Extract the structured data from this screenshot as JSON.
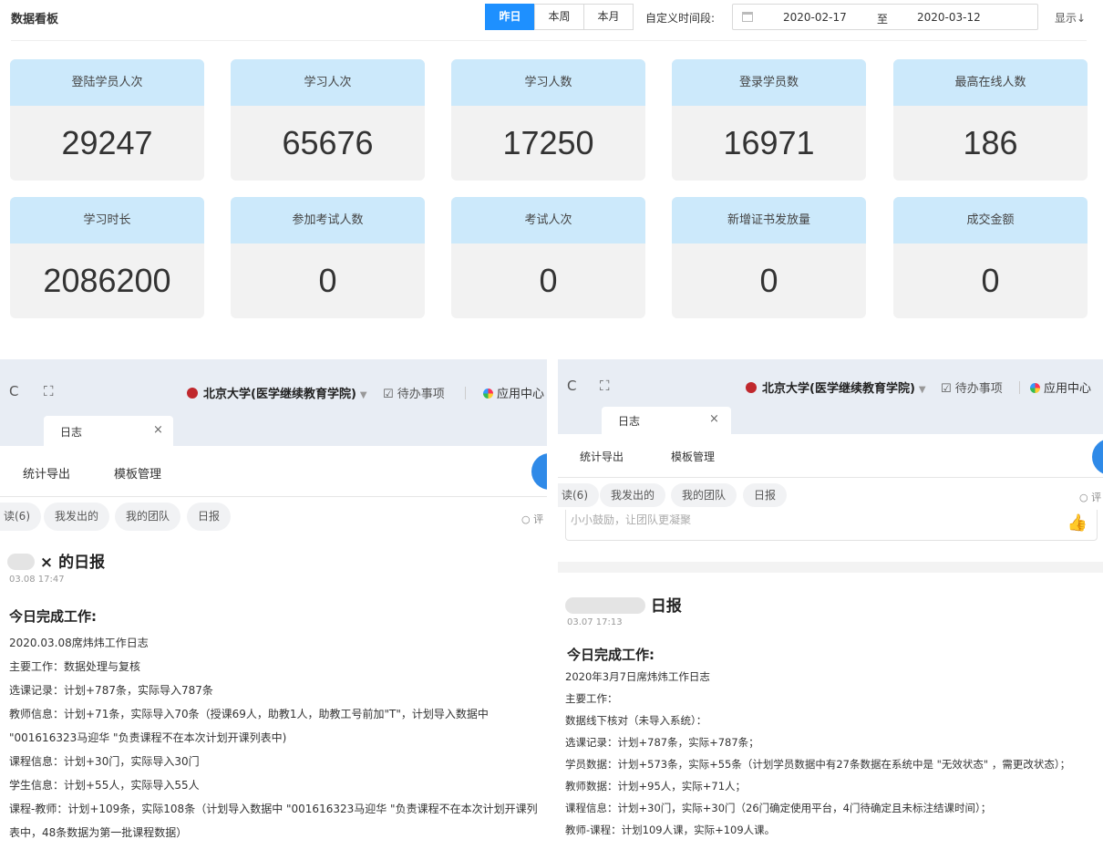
{
  "dashboard": {
    "title": "数据看板",
    "periods": [
      {
        "label": "昨日",
        "active": true
      },
      {
        "label": "本周",
        "active": false
      },
      {
        "label": "本月",
        "active": false
      }
    ],
    "custom_range_label": "自定义时间段:",
    "date_from": "2020-02-17",
    "date_sep": "至",
    "date_to": "2020-03-12",
    "show_toggle": "显示↓",
    "colors": {
      "accent": "#1e90ff",
      "card_header": "#cce9fb",
      "card_body": "#f2f2f2"
    },
    "cards": [
      {
        "label": "登陆学员人次",
        "value": "29247"
      },
      {
        "label": "学习人次",
        "value": "65676"
      },
      {
        "label": "学习人数",
        "value": "17250"
      },
      {
        "label": "登录学员数",
        "value": "16971"
      },
      {
        "label": "最高在线人数",
        "value": "186"
      },
      {
        "label": "学习时长",
        "value": "2086200"
      },
      {
        "label": "参加考试人数",
        "value": "0"
      },
      {
        "label": "考试人次",
        "value": "0"
      },
      {
        "label": "新增证书发放量",
        "value": "0"
      },
      {
        "label": "成交金额",
        "value": "0"
      }
    ]
  },
  "left_shot": {
    "refresh_icon": "C",
    "fullscreen_icon": "⛶",
    "org_name": "北京大学(医学继续教育学院)",
    "todo": "待办事项",
    "app_center": "应用中心",
    "tab_label": "日志",
    "tab_close": "×",
    "sub_nav": [
      "统计导出",
      "模板管理"
    ],
    "filters": [
      "读(6)",
      "我发出的",
      "我的团队",
      "日报"
    ],
    "comment_label": "评",
    "report": {
      "title_prefix": "× ",
      "title": "的日报",
      "time": "03.08 17:47",
      "heading": "今日完成工作:",
      "lines": [
        "2020.03.08席炜炜工作日志",
        "主要工作：数据处理与复核",
        "选课记录：计划+787条，实际导入787条",
        "教师信息：计划+71条，实际导入70条（授课69人，助教1人，助教工号前加\"T\"，计划导入数据中 \"001616323马迎华 \"负责课程不在本次计划开课列表中)",
        "课程信息：计划+30门，实际导入30门",
        "学生信息：计划+55人，实际导入55人",
        "课程-教师：计划+109条，实际108条（计划导入数据中 \"001616323马迎华 \"负责课程不在本次计划开课列表中，48条数据为第一批课程数据）"
      ]
    }
  },
  "right_shot": {
    "refresh_icon": "C",
    "fullscreen_icon": "⛶",
    "org_name": "北京大学(医学继续教育学院)",
    "todo": "待办事项",
    "app_center": "应用中心",
    "tab_label": "日志",
    "tab_close": "×",
    "sub_nav": [
      "统计导出",
      "模板管理"
    ],
    "filters": [
      "读(6)",
      "我发出的",
      "我的团队",
      "日报"
    ],
    "comment_label": "评",
    "encourage_placeholder": "小小鼓励，让团队更凝聚",
    "report": {
      "title_prefix": "",
      "title": "日报",
      "time": "03.07 17:13",
      "heading": "今日完成工作:",
      "lines": [
        "2020年3月7日席炜炜工作日志",
        "主要工作：",
        "数据线下核对（未导入系统）：",
        "选课记录：计划+787条，实际+787条；",
        "学员数据：计划+573条，实际+55条（计划学员数据中有27条数据在系统中是 \"无效状态\" ，需更改状态）；",
        "教师数据：计划+95人，实际+71人；",
        "课程信息：计划+30门，实际+30门（26门确定使用平台，4门待确定且未标注结课时间）；",
        "教师-课程：计划109人课，实际+109人课。"
      ]
    }
  }
}
